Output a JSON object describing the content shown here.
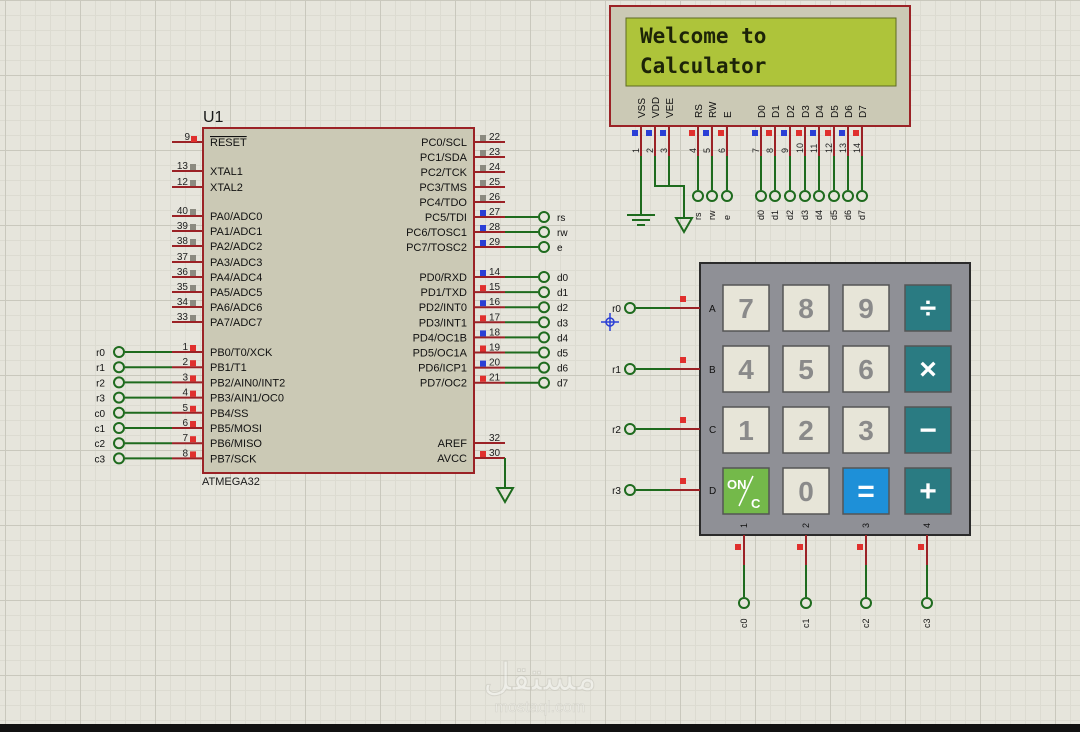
{
  "mcu": {
    "ref": "U1",
    "part": "ATMEGA32",
    "reset_pin": {
      "num": "9",
      "name": "RESET"
    },
    "left_pins": [
      {
        "num": "13",
        "name": "XTAL1"
      },
      {
        "num": "12",
        "name": "XTAL2"
      },
      {
        "num": "40",
        "name": "PA0/ADC0"
      },
      {
        "num": "39",
        "name": "PA1/ADC1"
      },
      {
        "num": "38",
        "name": "PA2/ADC2"
      },
      {
        "num": "37",
        "name": "PA3/ADC3"
      },
      {
        "num": "36",
        "name": "PA4/ADC4"
      },
      {
        "num": "35",
        "name": "PA5/ADC5"
      },
      {
        "num": "34",
        "name": "PA6/ADC6"
      },
      {
        "num": "33",
        "name": "PA7/ADC7"
      }
    ],
    "port_b_pins": [
      {
        "num": "1",
        "name": "PB0/T0/XCK",
        "net": "r0"
      },
      {
        "num": "2",
        "name": "PB1/T1",
        "net": "r1"
      },
      {
        "num": "3",
        "name": "PB2/AIN0/INT2",
        "net": "r2"
      },
      {
        "num": "4",
        "name": "PB3/AIN1/OC0",
        "net": "r3"
      },
      {
        "num": "5",
        "name": "PB4/SS",
        "net": "c0"
      },
      {
        "num": "6",
        "name": "PB5/MOSI",
        "net": "c1"
      },
      {
        "num": "7",
        "name": "PB6/MISO",
        "net": "c2"
      },
      {
        "num": "8",
        "name": "PB7/SCK",
        "net": "c3"
      }
    ],
    "port_c_pins": [
      {
        "num": "22",
        "name": "PC0/SCL",
        "net": ""
      },
      {
        "num": "23",
        "name": "PC1/SDA",
        "net": ""
      },
      {
        "num": "24",
        "name": "PC2/TCK",
        "net": ""
      },
      {
        "num": "25",
        "name": "PC3/TMS",
        "net": ""
      },
      {
        "num": "26",
        "name": "PC4/TDO",
        "net": ""
      },
      {
        "num": "27",
        "name": "PC5/TDI",
        "net": "rs"
      },
      {
        "num": "28",
        "name": "PC6/TOSC1",
        "net": "rw"
      },
      {
        "num": "29",
        "name": "PC7/TOSC2",
        "net": "e"
      }
    ],
    "port_d_pins": [
      {
        "num": "14",
        "name": "PD0/RXD",
        "net": "d0"
      },
      {
        "num": "15",
        "name": "PD1/TXD",
        "net": "d1"
      },
      {
        "num": "16",
        "name": "PD2/INT0",
        "net": "d2"
      },
      {
        "num": "17",
        "name": "PD3/INT1",
        "net": "d3"
      },
      {
        "num": "18",
        "name": "PD4/OC1B",
        "net": "d4"
      },
      {
        "num": "19",
        "name": "PD5/OC1A",
        "net": "d5"
      },
      {
        "num": "20",
        "name": "PD6/ICP1",
        "net": "d6"
      },
      {
        "num": "21",
        "name": "PD7/OC2",
        "net": "d7"
      }
    ],
    "power_pins": [
      {
        "num": "32",
        "name": "AREF"
      },
      {
        "num": "30",
        "name": "AVCC"
      }
    ]
  },
  "lcd": {
    "line1": "Welcome to",
    "line2": "Calculator",
    "pins": [
      {
        "name": "VSS",
        "num": "1"
      },
      {
        "name": "VDD",
        "num": "2"
      },
      {
        "name": "VEE",
        "num": "3"
      },
      {
        "name": "RS",
        "num": "4",
        "net": "rs"
      },
      {
        "name": "RW",
        "num": "5",
        "net": "rw"
      },
      {
        "name": "E",
        "num": "6",
        "net": "e"
      },
      {
        "name": "D0",
        "num": "7",
        "net": "d0"
      },
      {
        "name": "D1",
        "num": "8",
        "net": "d1"
      },
      {
        "name": "D2",
        "num": "9",
        "net": "d2"
      },
      {
        "name": "D3",
        "num": "10",
        "net": "d3"
      },
      {
        "name": "D4",
        "num": "11",
        "net": "d4"
      },
      {
        "name": "D5",
        "num": "12",
        "net": "d5"
      },
      {
        "name": "D6",
        "num": "13",
        "net": "d6"
      },
      {
        "name": "D7",
        "num": "14",
        "net": "d7"
      }
    ]
  },
  "keypad": {
    "rows": [
      {
        "letter": "A",
        "net": "r0"
      },
      {
        "letter": "B",
        "net": "r1"
      },
      {
        "letter": "C",
        "net": "r2"
      },
      {
        "letter": "D",
        "net": "r3"
      }
    ],
    "cols": [
      {
        "num": "1",
        "net": "c0"
      },
      {
        "num": "2",
        "net": "c1"
      },
      {
        "num": "3",
        "net": "c2"
      },
      {
        "num": "4",
        "net": "c3"
      }
    ],
    "keys": [
      [
        "7",
        "8",
        "9",
        "÷"
      ],
      [
        "4",
        "5",
        "6",
        "×"
      ],
      [
        "1",
        "2",
        "3",
        "−"
      ],
      [
        "ON/C",
        "0",
        "=",
        "+"
      ]
    ],
    "key_types": [
      [
        "num",
        "num",
        "num",
        "op"
      ],
      [
        "num",
        "num",
        "num",
        "op"
      ],
      [
        "num",
        "num",
        "num",
        "op"
      ],
      [
        "on",
        "num",
        "eq",
        "op"
      ]
    ]
  },
  "watermark": {
    "arabic": "مستقل",
    "latin": "mostaql.com"
  },
  "colors": {
    "wire": "#1e6b1e",
    "component_border": "#9b2226",
    "chip_fill": "#cbc9b5",
    "lcd_screen": "#aec43a",
    "keypad_frame": "#8f9096",
    "op_key": "#2a7b82",
    "eq_key": "#1e90d8",
    "on_key": "#74b94a",
    "pin_red": "#e0302e",
    "pin_blue": "#2a3fd6"
  }
}
